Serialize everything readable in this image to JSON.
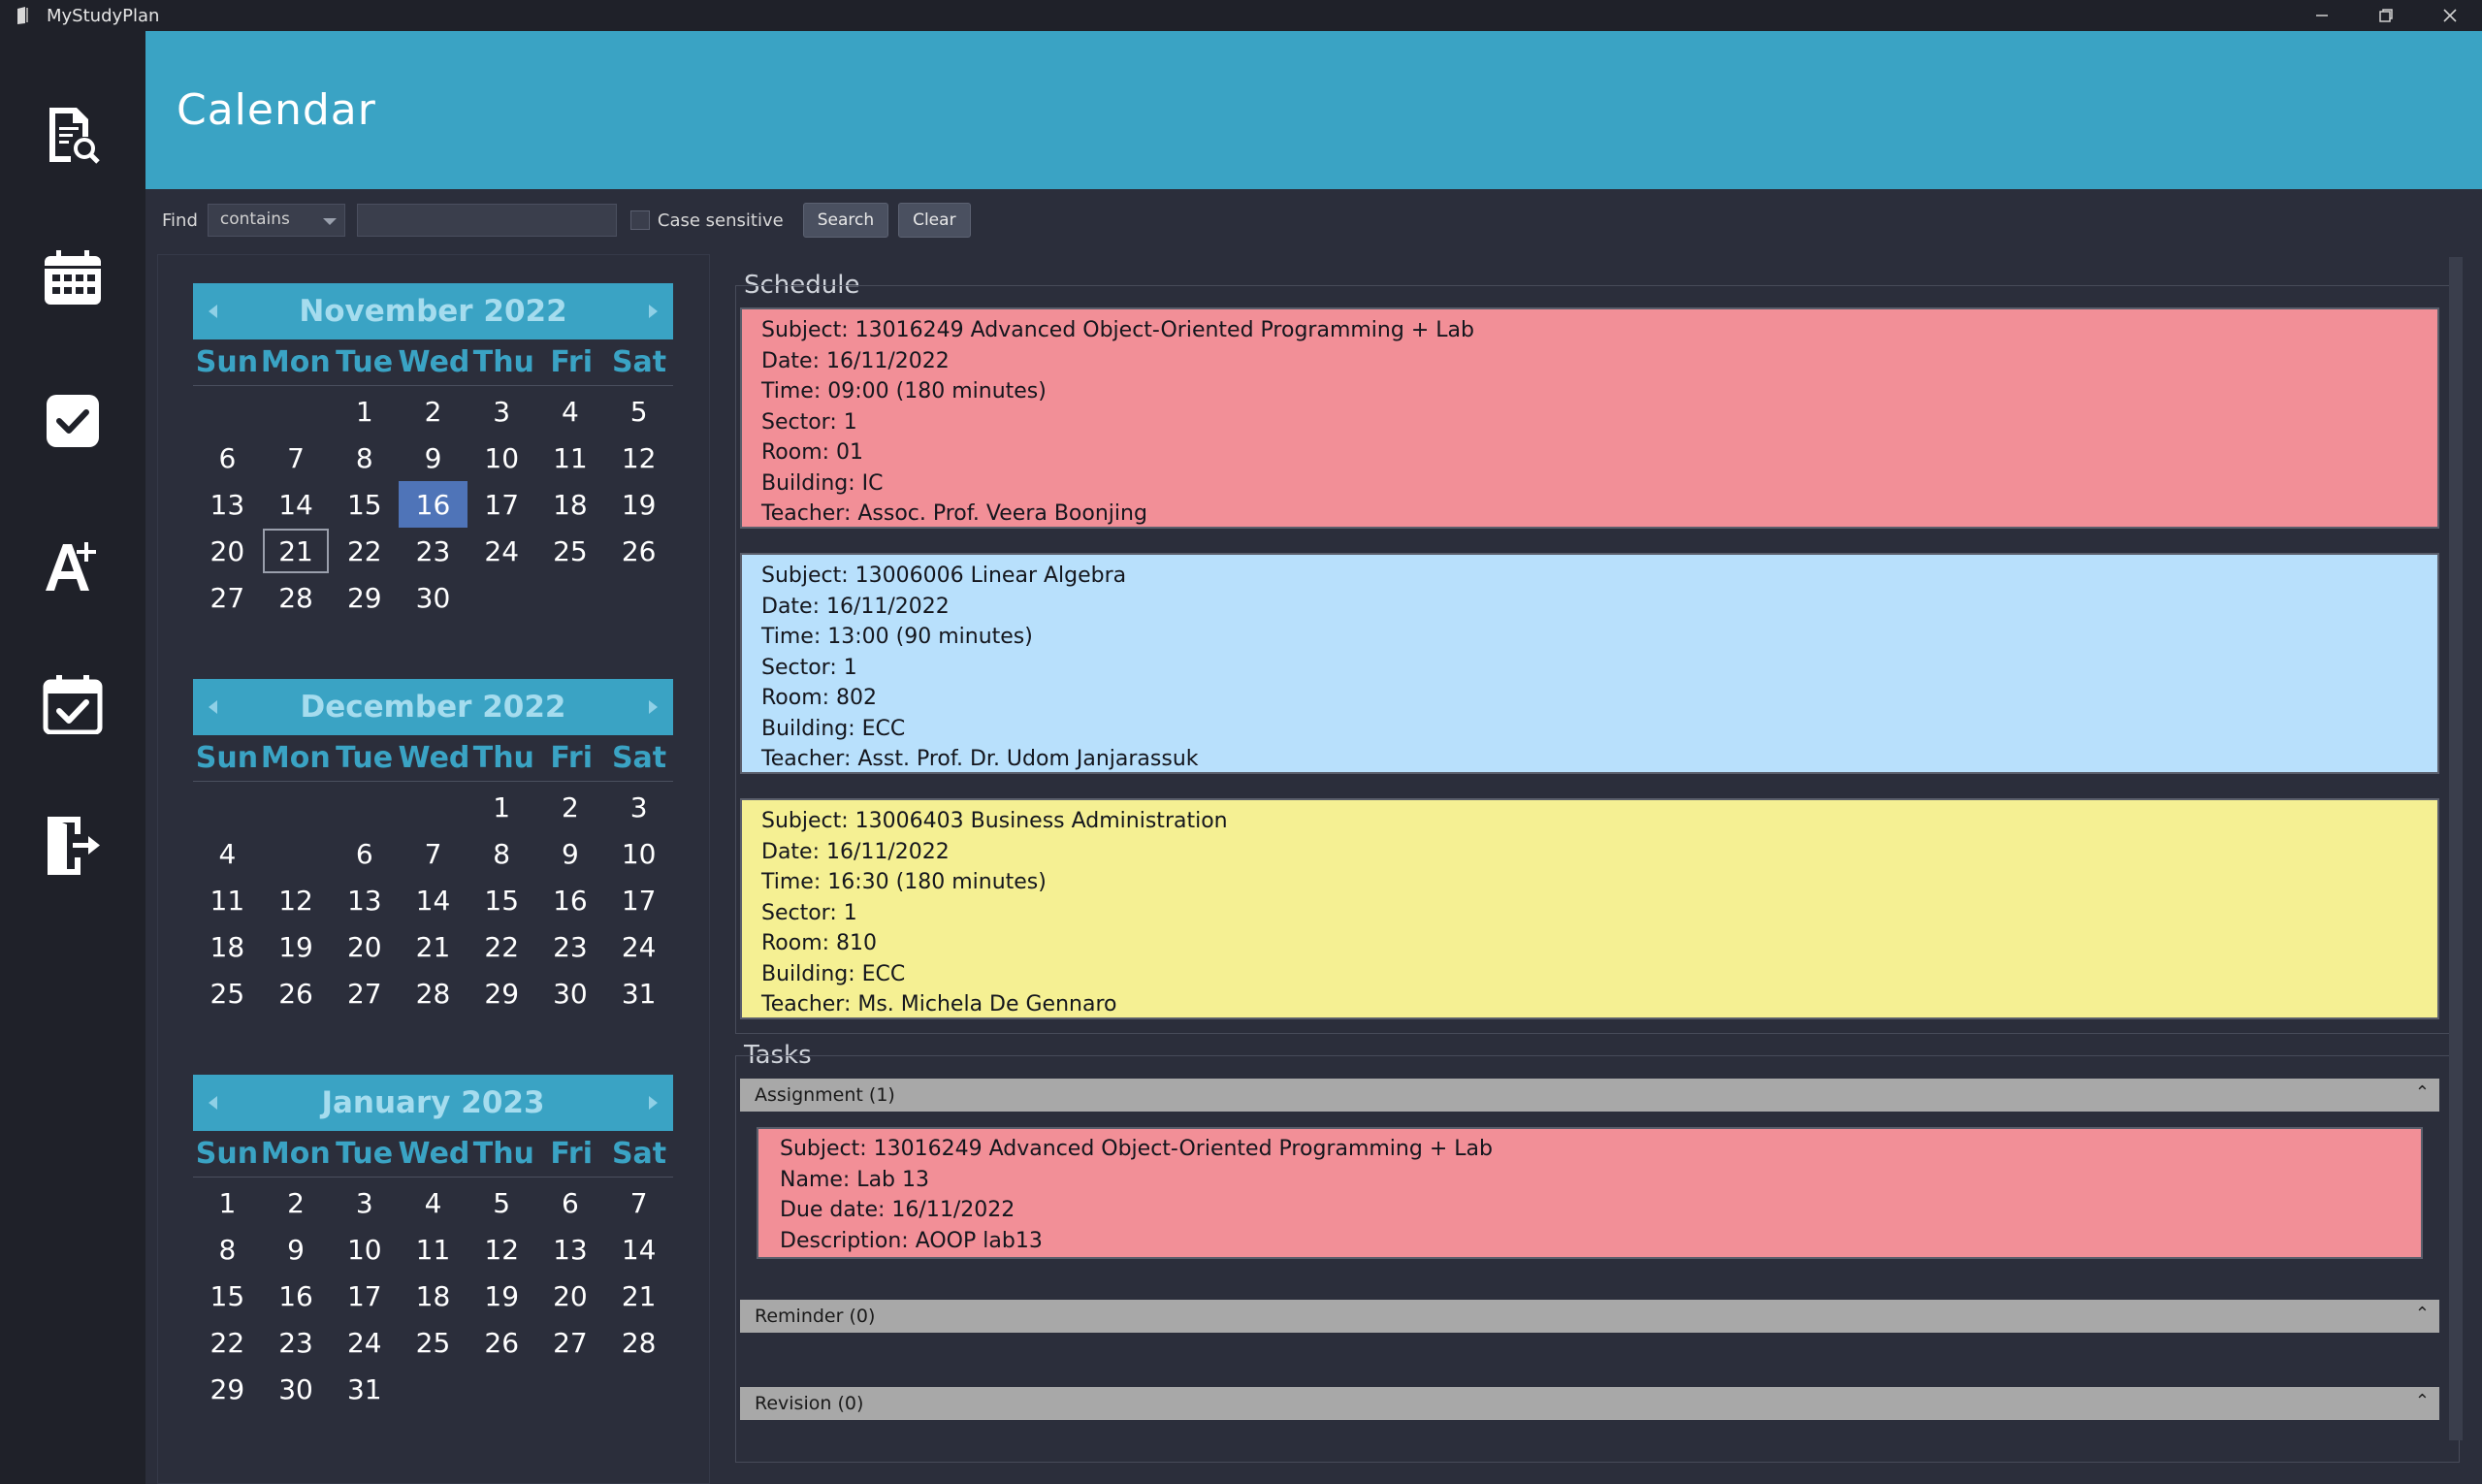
{
  "window": {
    "title": "MyStudyPlan",
    "controls": [
      "minimize",
      "restore",
      "close"
    ]
  },
  "sidebar": {
    "items": [
      {
        "name": "search-document",
        "icon": "document-search-icon"
      },
      {
        "name": "calendar",
        "icon": "calendar-icon"
      },
      {
        "name": "tasks",
        "icon": "checkbox-icon"
      },
      {
        "name": "grades",
        "icon": "grade-plus-icon"
      },
      {
        "name": "schedule",
        "icon": "calendar-check-icon"
      },
      {
        "name": "logout",
        "icon": "logout-icon"
      }
    ]
  },
  "header": {
    "title": "Calendar"
  },
  "find": {
    "label": "Find",
    "mode": "contains",
    "query": "",
    "case_label": "Case sensitive",
    "search_label": "Search",
    "clear_label": "Clear"
  },
  "calendars": [
    {
      "title": "November 2022",
      "dow": [
        "Sun",
        "Mon",
        "Tue",
        "Wed",
        "Thu",
        "Fri",
        "Sat"
      ],
      "offset": 2,
      "days": 30,
      "selected": 16,
      "today": 21
    },
    {
      "title": "December 2022",
      "dow": [
        "Sun",
        "Mon",
        "Tue",
        "Wed",
        "Thu",
        "Fri",
        "Sat"
      ],
      "offset": 4,
      "days": 31,
      "selected": null,
      "today": null,
      "hidden_days": [
        5
      ]
    },
    {
      "title": "January 2023",
      "dow": [
        "Sun",
        "Mon",
        "Tue",
        "Wed",
        "Thu",
        "Fri",
        "Sat"
      ],
      "offset": 0,
      "days": 31,
      "selected": null,
      "today": null
    }
  ],
  "schedule": {
    "label": "Schedule",
    "items": [
      {
        "color": "#f28f97",
        "lines": [
          "Subject: 13016249 Advanced Object-Oriented Programming + Lab",
          "Date: 16/11/2022",
          "Time: 09:00 (180 minutes)",
          "Sector: 1",
          "Room: 01",
          "Building: IC",
          "Teacher: Assoc. Prof. Veera Boonjing"
        ]
      },
      {
        "color": "#b8e0fc",
        "lines": [
          "Subject: 13006006 Linear Algebra",
          "Date: 16/11/2022",
          "Time: 13:00 (90 minutes)",
          "Sector: 1",
          "Room: 802",
          "Building: ECC",
          "Teacher: Asst. Prof. Dr. Udom Janjarassuk"
        ]
      },
      {
        "color": "#f5f093",
        "lines": [
          "Subject: 13006403 Business Administration",
          "Date: 16/11/2022",
          "Time: 16:30 (180 minutes)",
          "Sector: 1",
          "Room: 810",
          "Building: ECC",
          "Teacher: Ms. Michela De Gennaro"
        ]
      }
    ]
  },
  "tasks": {
    "label": "Tasks",
    "groups": [
      {
        "title": "Assignment (1)",
        "items": [
          {
            "lines": [
              "Subject: 13016249 Advanced Object-Oriented Programming + Lab",
              "Name: Lab 13",
              "Due date: 16/11/2022",
              "Description: AOOP lab13"
            ]
          }
        ]
      },
      {
        "title": "Reminder (0)",
        "items": []
      },
      {
        "title": "Revision (0)",
        "items": []
      }
    ]
  }
}
